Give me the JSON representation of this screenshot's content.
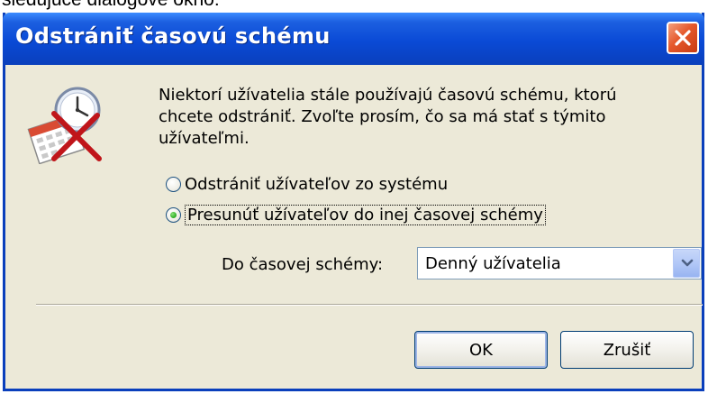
{
  "page": {
    "caption_fragment": "sledujúce dialógové okno:"
  },
  "dialog": {
    "title": "Odstrániť časovú schému",
    "message_lines": [
      "Niektorí užívatelia stále používajú časovú schému, ktorú",
      "chcete odstrániť. Zvoľte prosím, čo sa má stať s týmito",
      "užívateľmi."
    ],
    "options": [
      {
        "label": "Odstrániť užívateľov zo systému",
        "selected": false
      },
      {
        "label": "Presunúť užívateľov do inej časovej schémy",
        "selected": true
      }
    ],
    "schema_label": "Do časovej schémy:",
    "schema_value": "Denný užívatelia",
    "ok_label": "OK",
    "cancel_label": "Zrušiť"
  },
  "icons": {
    "dialog": "clock-calendar-delete-icon",
    "close": "close-icon",
    "dropdown": "chevron-down-icon"
  },
  "colors": {
    "titlebar": "#0a4ad6",
    "close_button": "#e5582b",
    "dialog_background": "#ece9d8",
    "selected_radio": "#35b52a"
  }
}
